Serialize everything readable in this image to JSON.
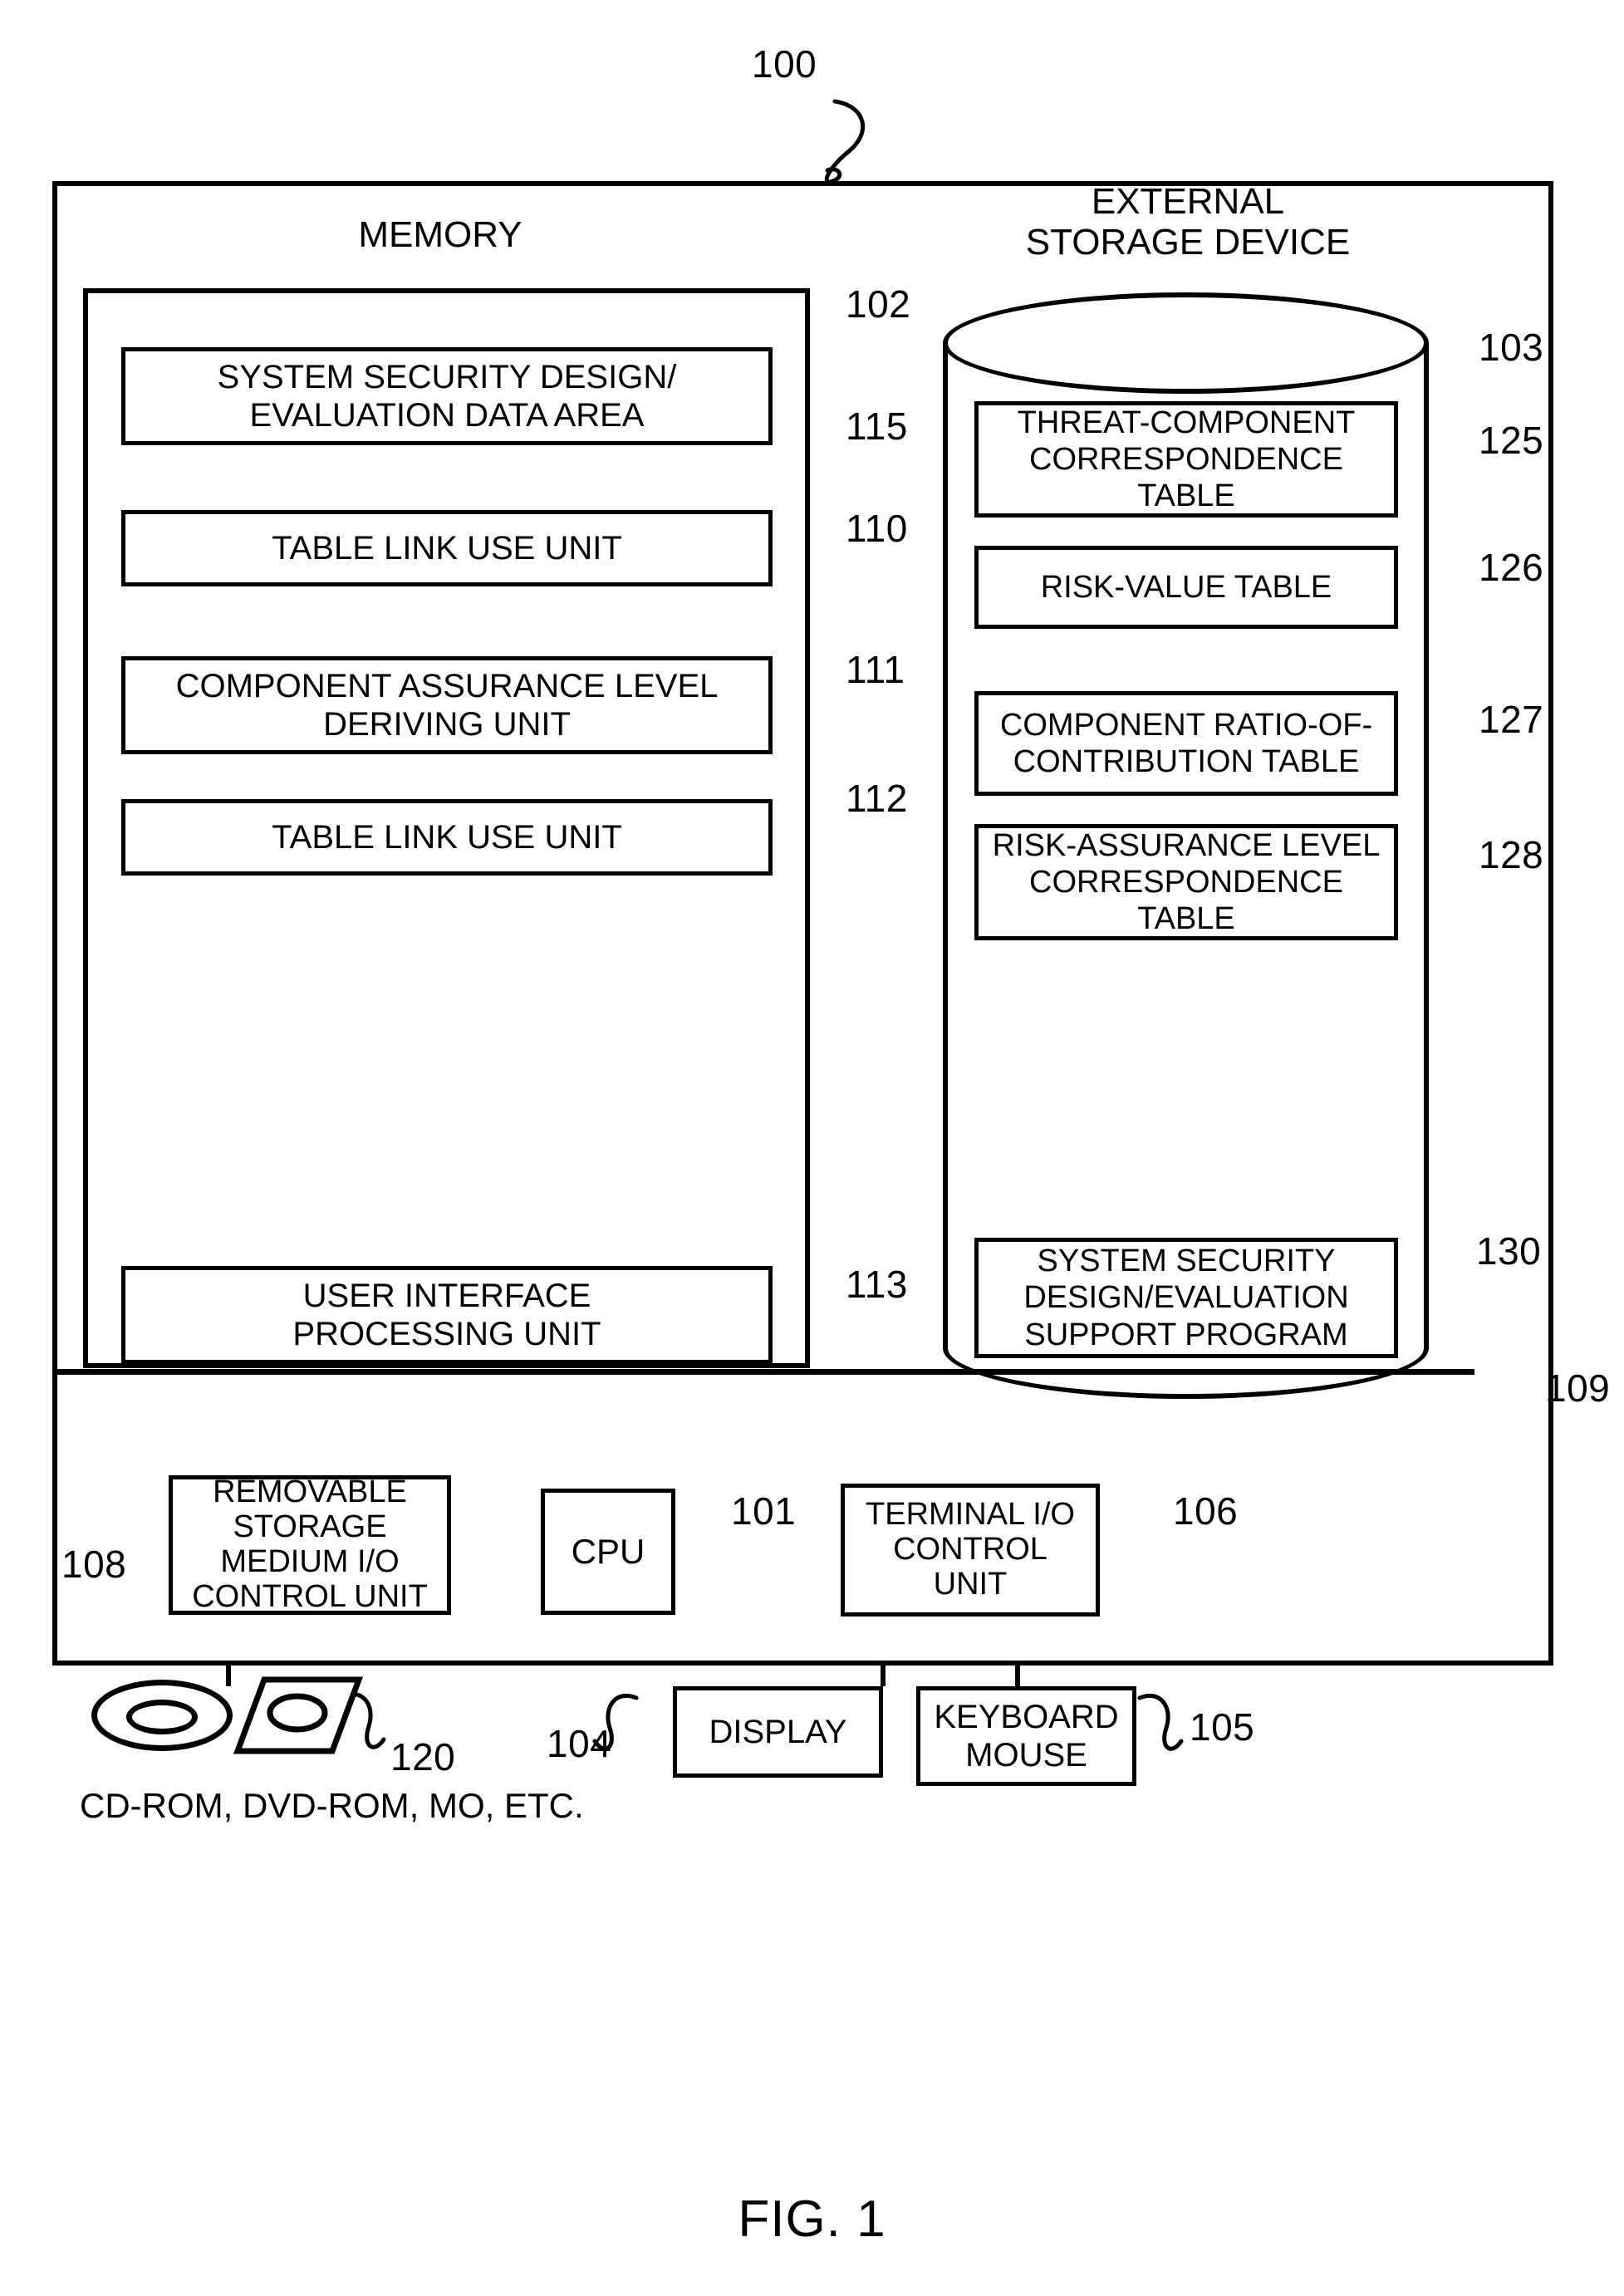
{
  "figure": {
    "caption": "FIG. 1",
    "system_ref": "100"
  },
  "memory": {
    "heading": "MEMORY",
    "ref": "102",
    "units": [
      {
        "label": "SYSTEM SECURITY DESIGN/\nEVALUATION DATA AREA",
        "ref": "115"
      },
      {
        "label": "TABLE LINK USE UNIT",
        "ref": "110"
      },
      {
        "label": "COMPONENT ASSURANCE LEVEL\nDERIVING UNIT",
        "ref": "111"
      },
      {
        "label": "TABLE LINK USE UNIT",
        "ref": "112"
      },
      {
        "label": "USER INTERFACE\nPROCESSING UNIT",
        "ref": "113"
      }
    ]
  },
  "external_storage": {
    "heading": "EXTERNAL\nSTORAGE DEVICE",
    "ref": "103",
    "units": [
      {
        "label": "THREAT-COMPONENT\nCORRESPONDENCE\nTABLE",
        "ref": "125"
      },
      {
        "label": "RISK-VALUE TABLE",
        "ref": "126"
      },
      {
        "label": "COMPONENT RATIO-OF-\nCONTRIBUTION TABLE",
        "ref": "127"
      },
      {
        "label": "RISK-ASSURANCE LEVEL\nCORRESPONDENCE\nTABLE",
        "ref": "128"
      },
      {
        "label": "SYSTEM SECURITY\nDESIGN/EVALUATION\nSUPPORT PROGRAM",
        "ref": "130"
      }
    ]
  },
  "bus": {
    "ref": "109"
  },
  "hardware": [
    {
      "label": "REMOVABLE\nSTORAGE\nMEDIUM I/O\nCONTROL UNIT",
      "ref": "108"
    },
    {
      "label": "CPU",
      "ref": "101"
    },
    {
      "label": "TERMINAL I/O\nCONTROL\nUNIT",
      "ref": "106"
    }
  ],
  "peripherals": [
    {
      "label": "DISPLAY",
      "ref": "104"
    },
    {
      "label": "KEYBOARD\nMOUSE",
      "ref": "105"
    }
  ],
  "media": {
    "ref": "120",
    "caption": "CD-ROM, DVD-ROM, MO, ETC.",
    "icons": [
      "cd-disc-icon",
      "mo-disk-icon"
    ]
  },
  "colors": {
    "ink": "#000000",
    "paper": "#ffffff"
  }
}
